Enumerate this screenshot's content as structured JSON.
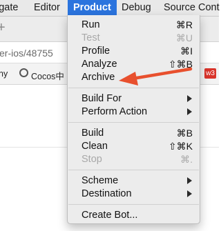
{
  "menubar": {
    "items": [
      "igate",
      "Editor",
      "Product",
      "Debug",
      "Source Cont"
    ],
    "active_index": 2
  },
  "background": {
    "url_text": "er-ios/48755",
    "bookmarks": [
      "ny",
      "Cocos中"
    ],
    "badge": "w3"
  },
  "menu": {
    "groups": [
      [
        {
          "label": "Run",
          "shortcut": "⌘R",
          "enabled": true
        },
        {
          "label": "Test",
          "shortcut": "⌘U",
          "enabled": false
        },
        {
          "label": "Profile",
          "shortcut": "⌘I",
          "enabled": true
        },
        {
          "label": "Analyze",
          "shortcut": "⇧⌘B",
          "enabled": true
        },
        {
          "label": "Archive",
          "shortcut": "",
          "enabled": true
        }
      ],
      [
        {
          "label": "Build For",
          "submenu": true,
          "enabled": true
        },
        {
          "label": "Perform Action",
          "submenu": true,
          "enabled": true
        }
      ],
      [
        {
          "label": "Build",
          "shortcut": "⌘B",
          "enabled": true
        },
        {
          "label": "Clean",
          "shortcut": "⇧⌘K",
          "enabled": true
        },
        {
          "label": "Stop",
          "shortcut": "⌘.",
          "enabled": false
        }
      ],
      [
        {
          "label": "Scheme",
          "submenu": true,
          "enabled": true
        },
        {
          "label": "Destination",
          "submenu": true,
          "enabled": true
        }
      ],
      [
        {
          "label": "Create Bot...",
          "shortcut": "",
          "enabled": true
        }
      ]
    ]
  },
  "colors": {
    "active_menu_bg": "#2b74de",
    "annotation_arrow": "#e8502e",
    "disabled_text": "#a9a9a9"
  }
}
